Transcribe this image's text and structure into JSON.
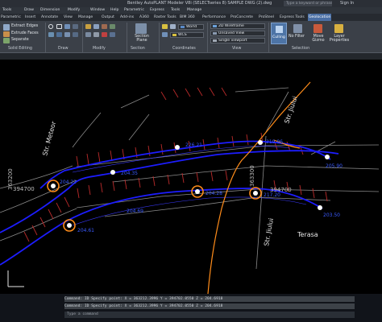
{
  "title_bar": {
    "title": "Bentley AutoPLANT Modeler V8i (SELECTseries 8)  SAMPLE DWG (2).dwg",
    "search_placeholder": "Type a keyword or phrase",
    "sign_in": "Sign In"
  },
  "menu": [
    "Tools",
    "Draw",
    "Dimension",
    "Modify",
    "Window",
    "Help",
    "Parametric",
    "Express",
    "Tools",
    "Manage"
  ],
  "menu2": [
    "Output",
    "Add-ins",
    "Raster Tools",
    "BIM 360",
    "Performance",
    "ProConcrete",
    "ProSteel",
    "Express Tools",
    "Geolocation"
  ],
  "tabs": [
    "Parametric",
    "Insert",
    "Annotate",
    "View",
    "Manage",
    "Output",
    "A360",
    "Accel",
    "ProStructures",
    "Express"
  ],
  "ribbon": {
    "solid_editing": {
      "buttons": [
        "Extract Edges",
        "Extrude Faces",
        "Separate"
      ],
      "label": "Solid Editing"
    },
    "draw_label": "Draw",
    "modify_label": "Modify",
    "section": {
      "button": "Section Plane",
      "label": "Section"
    },
    "coordinates": {
      "ucs": "World",
      "ucs2": "WCS",
      "label": "Coordinates"
    },
    "view": {
      "visual_style": "2D Wireframe",
      "saved_view": "Unsaved View",
      "viewport": "Single viewport",
      "label": "View"
    },
    "selection": {
      "culling": "Culling",
      "no_filter": "No Filter",
      "move_gizmo": "Move Gizmo",
      "layer_properties": "Layer Properties",
      "label": "Selection"
    }
  },
  "canvas": {
    "streets": [
      "Str. Meteor",
      "Str. Jiului",
      "Str. Jiului",
      "Terasa"
    ],
    "grid_labels": [
      "363200",
      "394700",
      "363300",
      "394700"
    ],
    "point_labels": [
      "226.21",
      "204.35",
      "219.96",
      "204.22",
      "204.69",
      "204.28",
      "204.61",
      "217.20",
      "205.90",
      "203.50"
    ]
  },
  "command": {
    "history": [
      "Command: ID Specify point:  X = 363212.3996      Y = 394702.0550      Z = 204.6918",
      "Command: ID Specify point:  X = 363212.3996      Y = 394702.0550      Z = 204.6918"
    ],
    "prompt": "Type a command"
  },
  "colors": {
    "road": "#1d1dff",
    "orange": "#ff8c1a",
    "ticks": "#b82a2a",
    "axis": "#e8e8e8"
  }
}
